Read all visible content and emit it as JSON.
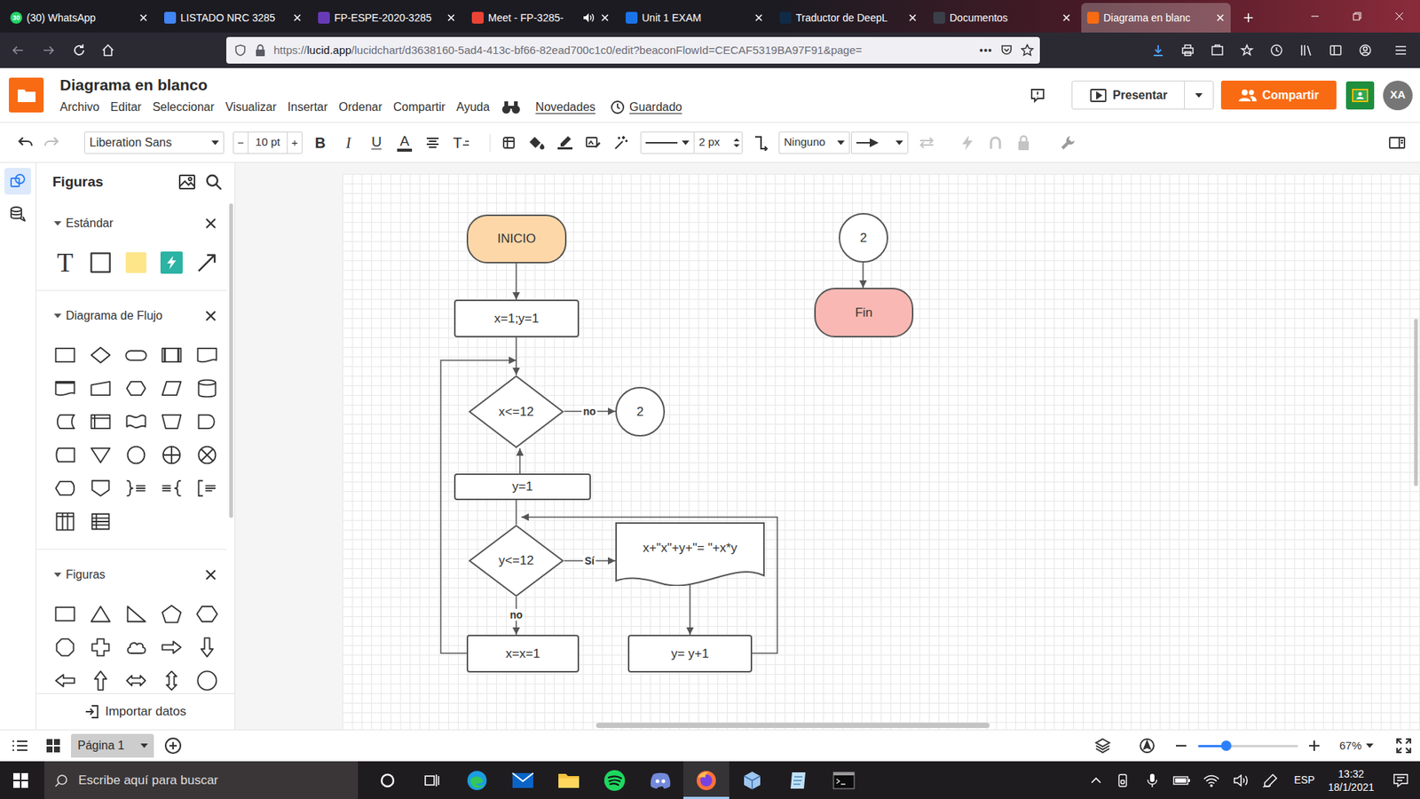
{
  "browser": {
    "tabs": [
      {
        "label": "(30) WhatsApp",
        "badge": "30",
        "audio": false,
        "selected": false,
        "color": "#25d366"
      },
      {
        "label": "LISTADO NRC 3285",
        "audio": false,
        "selected": false,
        "color": "#4285f4"
      },
      {
        "label": "FP-ESPE-2020-3285",
        "audio": false,
        "selected": false,
        "color": "#673ab7"
      },
      {
        "label": "Meet - FP-3285-",
        "audio": true,
        "selected": false,
        "color": "#ea4335"
      },
      {
        "label": "Unit 1 EXAM",
        "audio": false,
        "selected": false,
        "color": "#1a73e8"
      },
      {
        "label": "Traductor de DeepL",
        "audio": false,
        "selected": false,
        "color": "#0f2b46"
      },
      {
        "label": "Documentos",
        "audio": false,
        "selected": false,
        "color": "#3a3f4a"
      },
      {
        "label": "Diagrama en blanc",
        "audio": false,
        "selected": true,
        "color": "#f96b13"
      }
    ],
    "url": {
      "scheme": "https://",
      "host": "lucid.app",
      "path": "/lucidchart/d3638160-5ad4-413c-bf66-82ead700c1c0/edit?beaconFlowId=CECAF5319BA97F91&page="
    },
    "page_actions": "•••"
  },
  "app": {
    "title": "Diagrama en blanco",
    "menu": [
      "Archivo",
      "Editar",
      "Seleccionar",
      "Visualizar",
      "Insertar",
      "Ordenar",
      "Compartir",
      "Ayuda"
    ],
    "news": "Novedades",
    "saved": "Guardado",
    "present": "Presentar",
    "share": "Compartir",
    "avatar": "XA"
  },
  "toolbar": {
    "font": "Liberation Sans",
    "size_minus": "−",
    "font_size": "10 pt",
    "size_plus": "+",
    "bold": "B",
    "italic": "I",
    "underline": "U",
    "font_color": "A",
    "text_options": "T",
    "line_width": "2 px",
    "line_end": "Ninguno"
  },
  "rail": [
    {
      "selected": true
    },
    {
      "selected": false
    }
  ],
  "panel": {
    "title": "Figuras",
    "sections": [
      {
        "title": "Estándar",
        "expanded": true
      },
      {
        "title": "Diagrama de Flujo",
        "expanded": true
      },
      {
        "title": "Figuras",
        "expanded": true
      }
    ],
    "text_shape": "T",
    "import": "Importar datos"
  },
  "diagram": {
    "nodes": [
      {
        "kind": "terminal",
        "label": "INICIO",
        "color": "#fed7a8"
      },
      {
        "kind": "process",
        "label": "x=1;y=1",
        "color": "#ffffff"
      },
      {
        "kind": "decision",
        "label": "x<=12",
        "color": "#ffffff"
      },
      {
        "kind": "connector",
        "label": "2",
        "color": "#ffffff"
      },
      {
        "kind": "process",
        "label": "y=1",
        "color": "#ffffff"
      },
      {
        "kind": "decision",
        "label": "y<=12",
        "color": "#ffffff"
      },
      {
        "kind": "document",
        "label": "x+\"x\"+y+\"= \"+x*y",
        "color": "#ffffff"
      },
      {
        "kind": "process",
        "label": "x=x=1",
        "color": "#ffffff"
      },
      {
        "kind": "process",
        "label": "y= y+1",
        "color": "#ffffff"
      },
      {
        "kind": "connector",
        "label": "2",
        "color": "#ffffff"
      },
      {
        "kind": "terminal",
        "label": "Fin",
        "color": "#f9b8b3"
      }
    ],
    "edge_labels": [
      "no",
      "Sí",
      "no"
    ]
  },
  "footer": {
    "page": "Página 1",
    "zoom": "67%",
    "zoom_level": 0.28
  },
  "taskbar": {
    "search": "Escribe aquí para buscar",
    "lang": "ESP",
    "time": "13:32",
    "date": "18/1/2021"
  }
}
